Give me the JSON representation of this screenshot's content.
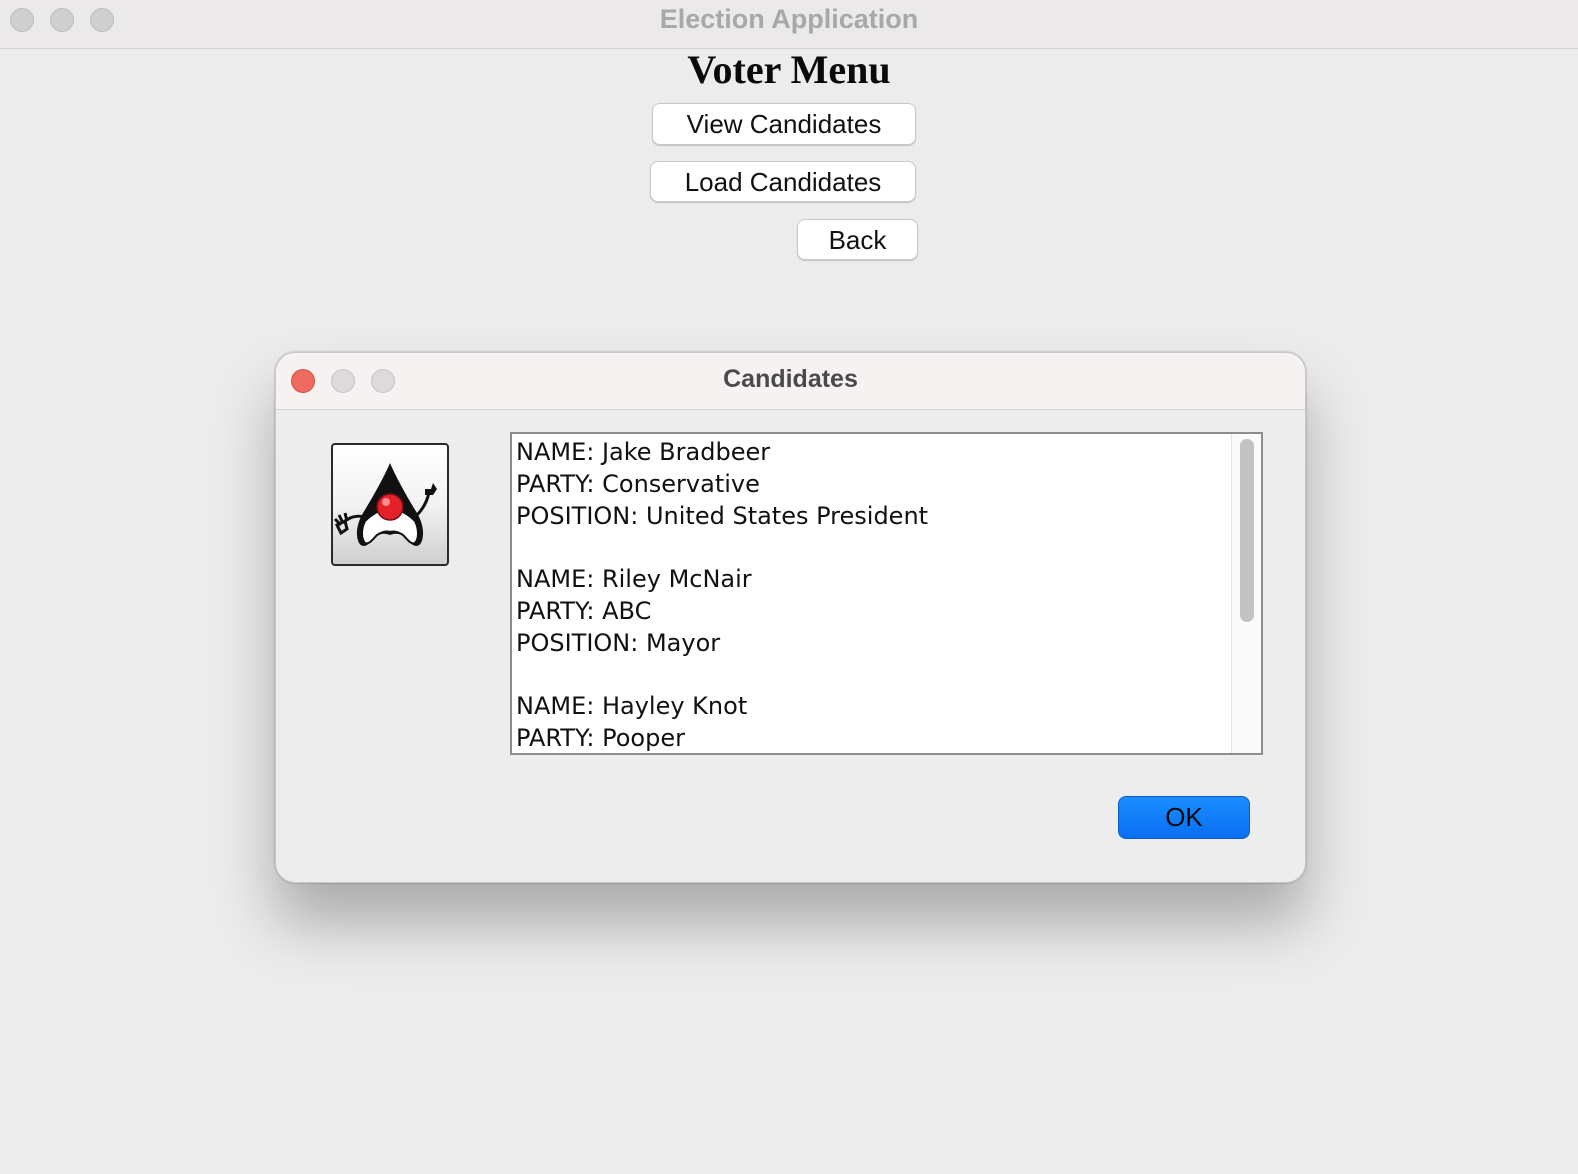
{
  "window": {
    "title": "Election Application"
  },
  "voter_menu": {
    "heading": "Voter Menu",
    "view_candidates_label": "View Candidates",
    "load_candidates_label": "Load Candidates",
    "back_label": "Back"
  },
  "dialog": {
    "title": "Candidates",
    "icon": "duke-java-icon",
    "text_lines": [
      "NAME: Jake Bradbeer",
      "PARTY: Conservative",
      "POSITION: United States President",
      "",
      "NAME: Riley McNair",
      "PARTY: ABC",
      "POSITION: Mayor",
      "",
      "NAME: Hayley Knot",
      "PARTY: Pooper"
    ],
    "ok_label": "OK"
  },
  "colors": {
    "close_button": "#ec6a5e",
    "ok_button": "#0a7aff",
    "inactive_traffic": "#d0cfcf"
  }
}
